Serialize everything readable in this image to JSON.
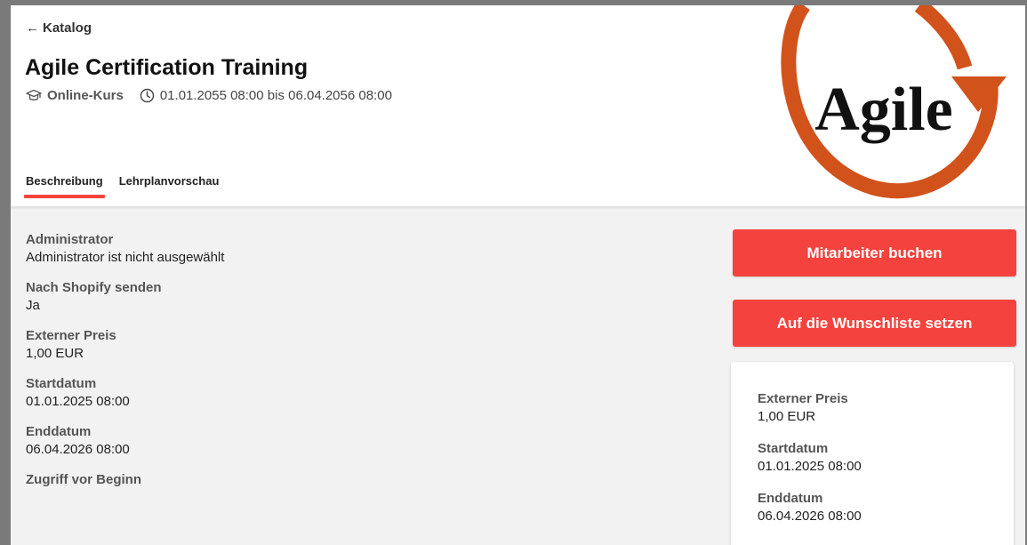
{
  "nav": {
    "back_label": "Katalog"
  },
  "course": {
    "title": "Agile Certification Training",
    "type": "Online-Kurs",
    "date_range": "01.01.2055 08:00 bis 06.04.2056 08:00",
    "logo_text": "Agile"
  },
  "tabs": [
    {
      "label": "Beschreibung",
      "active": true
    },
    {
      "label": "Lehrplanvorschau",
      "active": false
    }
  ],
  "details": [
    {
      "label": "Administrator",
      "value": "Administrator ist nicht ausgewählt"
    },
    {
      "label": "Nach Shopify senden",
      "value": "Ja"
    },
    {
      "label": "Externer Preis",
      "value": "1,00 EUR"
    },
    {
      "label": "Startdatum",
      "value": "01.01.2025 08:00"
    },
    {
      "label": "Enddatum",
      "value": "06.04.2026 08:00"
    },
    {
      "label": "Zugriff vor Beginn",
      "value": ""
    }
  ],
  "actions": {
    "book_label": "Mitarbeiter buchen",
    "wishlist_label": "Auf die Wunschliste setzen"
  },
  "summary": [
    {
      "label": "Externer Preis",
      "value": "1,00 EUR"
    },
    {
      "label": "Startdatum",
      "value": "01.01.2025 08:00"
    },
    {
      "label": "Enddatum",
      "value": "06.04.2026 08:00"
    }
  ],
  "colors": {
    "accent": "#f4433e",
    "logo_orange": "#d2521c"
  }
}
